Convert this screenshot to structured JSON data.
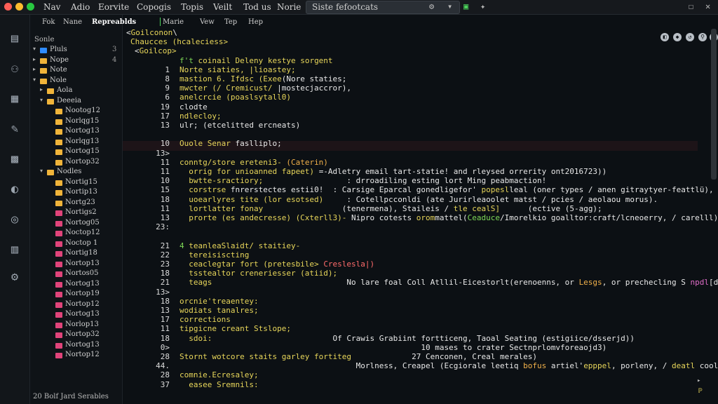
{
  "window": {
    "colors": {
      "close": "#ff5f57",
      "min": "#febc2e",
      "max": "#28c840"
    }
  },
  "menubar": {
    "items": [
      "Nav",
      "Adio",
      "Eorvite",
      "Copogis",
      "Topis",
      "Veilt",
      "Tod us",
      "Norie"
    ],
    "search_value": "Siste fefootcats"
  },
  "editor_menu": {
    "items": [
      "Fok",
      "Nane",
      "Repreablds",
      "Marie",
      "Vew",
      "Tep",
      "Hep"
    ]
  },
  "sidebar": {
    "title": "Sonle",
    "footer": "20 Bolf Jard Serables",
    "rows": [
      {
        "label": "Pluls",
        "color": "#2f8cff",
        "indent": 1,
        "chev": "▾",
        "num": "3"
      },
      {
        "label": "Nope",
        "color": "#f0b43a",
        "indent": 1,
        "chev": "▸",
        "num": "4"
      },
      {
        "label": "Note",
        "color": "#f0b43a",
        "indent": 1,
        "chev": "▸",
        "num": ""
      },
      {
        "label": "Nole",
        "color": "#f0b43a",
        "indent": 1,
        "chev": "▾",
        "num": ""
      },
      {
        "label": "Aola",
        "color": "#f0b43a",
        "indent": 2,
        "chev": "▸",
        "num": ""
      },
      {
        "label": "Deeeia",
        "color": "#f0b43a",
        "indent": 2,
        "chev": "▾",
        "num": ""
      },
      {
        "label": "Nootog12",
        "color": "#f0b43a",
        "indent": 3,
        "chev": "",
        "num": ""
      },
      {
        "label": "Norlqg15",
        "color": "#f0b43a",
        "indent": 3,
        "chev": "",
        "num": ""
      },
      {
        "label": "Nortog13",
        "color": "#f0b43a",
        "indent": 3,
        "chev": "",
        "num": ""
      },
      {
        "label": "Norlqg13",
        "color": "#f0b43a",
        "indent": 3,
        "chev": "",
        "num": ""
      },
      {
        "label": "Nortog15",
        "color": "#f0b43a",
        "indent": 3,
        "chev": "",
        "num": ""
      },
      {
        "label": "Nortop32",
        "color": "#f0b43a",
        "indent": 3,
        "chev": "",
        "num": ""
      },
      {
        "label": "Nodles",
        "color": "#f0b43a",
        "indent": 2,
        "chev": "▾",
        "num": ""
      },
      {
        "label": "Nortig15",
        "color": "#f0b43a",
        "indent": 3,
        "chev": "",
        "num": ""
      },
      {
        "label": "Nortip13",
        "color": "#f0b43a",
        "indent": 3,
        "chev": "",
        "num": ""
      },
      {
        "label": "Nortg23",
        "color": "#f0b43a",
        "indent": 3,
        "chev": "",
        "num": ""
      },
      {
        "label": "Nortigs2",
        "color": "#e0447a",
        "indent": 3,
        "chev": "",
        "num": ""
      },
      {
        "label": "Nortog05",
        "color": "#e0447a",
        "indent": 3,
        "chev": "",
        "num": ""
      },
      {
        "label": "Noctop12",
        "color": "#e0447a",
        "indent": 3,
        "chev": "",
        "num": ""
      },
      {
        "label": "Noctop 1",
        "color": "#e0447a",
        "indent": 3,
        "chev": "",
        "num": ""
      },
      {
        "label": "Nortig18",
        "color": "#e0447a",
        "indent": 3,
        "chev": "",
        "num": ""
      },
      {
        "label": "Nortop13",
        "color": "#e0447a",
        "indent": 3,
        "chev": "",
        "num": ""
      },
      {
        "label": "Nortos05",
        "color": "#e0447a",
        "indent": 3,
        "chev": "",
        "num": ""
      },
      {
        "label": "Nortog13",
        "color": "#e0447a",
        "indent": 3,
        "chev": "",
        "num": ""
      },
      {
        "label": "Nortop19",
        "color": "#e0447a",
        "indent": 3,
        "chev": "",
        "num": ""
      },
      {
        "label": "Nortop12",
        "color": "#e0447a",
        "indent": 3,
        "chev": "",
        "num": ""
      },
      {
        "label": "Nortog13",
        "color": "#e0447a",
        "indent": 3,
        "chev": "",
        "num": ""
      },
      {
        "label": "Norlop13",
        "color": "#e0447a",
        "indent": 3,
        "chev": "",
        "num": ""
      },
      {
        "label": "Nortop32",
        "color": "#e0447a",
        "indent": 3,
        "chev": "",
        "num": ""
      },
      {
        "label": "Nortog13",
        "color": "#e0447a",
        "indent": 3,
        "chev": "",
        "num": ""
      },
      {
        "label": "Nortop12",
        "color": "#e0447a",
        "indent": 3,
        "chev": "",
        "num": ""
      }
    ]
  },
  "code_lines": [
    {
      "num": "",
      "parts": [
        [
          "w",
          "<"
        ],
        [
          "y",
          "Goilconon"
        ],
        [
          "w",
          "\\"
        ]
      ]
    },
    {
      "num": "",
      "parts": [
        [
          "y",
          "Chaucces (hcaleciess>"
        ]
      ]
    },
    {
      "num": "",
      "parts": [
        [
          "w",
          "<"
        ],
        [
          "y",
          "Goilcop>"
        ]
      ]
    },
    {
      "num": "",
      "parts": [
        [
          "g",
          "f't "
        ],
        [
          "y",
          "coinail Deleny kestye sorgent"
        ]
      ]
    },
    {
      "num": "1",
      "parts": [
        [
          "y",
          "Norte siaties, |lioastey;"
        ]
      ]
    },
    {
      "num": "8",
      "parts": [
        [
          "y",
          "mastion 6. Ifdsc (Exee"
        ],
        [
          "w",
          "(Nore staties;"
        ]
      ]
    },
    {
      "num": "9",
      "parts": [
        [
          "y",
          "mwcter (/ Cremicust/ "
        ],
        [
          "w",
          "|mostecjaccror),"
        ]
      ]
    },
    {
      "num": "6",
      "parts": [
        [
          "y",
          "anelcrcie (poaslsytall0)"
        ]
      ]
    },
    {
      "num": "19",
      "parts": [
        [
          "w",
          "clodte"
        ]
      ]
    },
    {
      "num": "17",
      "parts": [
        [
          "y",
          "ndlecloy;"
        ]
      ]
    },
    {
      "num": "13",
      "parts": [
        [
          "w",
          "ulr; (etcelitted ercneats)"
        ]
      ]
    },
    {
      "num": "",
      "parts": []
    },
    {
      "num": "10",
      "parts": [
        [
          "y",
          "Ouole Senar "
        ],
        [
          "w",
          "faslliplo;"
        ]
      ]
    },
    {
      "num": "13>",
      "parts": []
    },
    {
      "num": "11",
      "parts": [
        [
          "y",
          "conntg/store ereteni3- "
        ],
        [
          "o",
          "(Caterin)"
        ]
      ]
    },
    {
      "num": "11",
      "parts": [
        [
          "y",
          "  orrig for unioanned fapeet) "
        ],
        [
          "w",
          "=-Adletry email tart-statie! and rleysed orrerity ont2016723))"
        ]
      ]
    },
    {
      "num": "10",
      "parts": [
        [
          "y",
          "  bwtte-sractiory;                  "
        ],
        [
          "w",
          ": drroadiling esting lort Ming peabmaction!"
        ]
      ]
    },
    {
      "num": "15",
      "parts": [
        [
          "y",
          "  corstrse "
        ],
        [
          "w",
          "fnrerstectes estii0!  "
        ],
        [
          "w",
          ": Carsige Eparcal gonedligefor' "
        ],
        [
          "y",
          "popesl"
        ],
        [
          "w",
          "leal (oner types / anen gitraytyer-feattlü),"
        ]
      ]
    },
    {
      "num": "18",
      "parts": [
        [
          "y",
          "  uoearlyres tite (lor esotsed)     "
        ],
        [
          "w",
          ": Cotellpcconldi (ate Jurirleaoolet matst / pcies / aeolaou morus)."
        ]
      ]
    },
    {
      "num": "11",
      "parts": [
        [
          "y",
          "  lortlatter fonay"
        ],
        [
          "w",
          "                 (tenermena), Staileis / "
        ],
        [
          "y",
          "tle cealS]"
        ],
        [
          "w",
          "      (ective (5-agg);"
        ]
      ]
    },
    {
      "num": "13",
      "parts": [
        [
          "y",
          "  prorte (es andecresse) (Cxterll3)- "
        ],
        [
          "w",
          "Nipro cotests "
        ],
        [
          "y",
          "orom"
        ],
        [
          "w",
          "mattel("
        ],
        [
          "g",
          "Ceaduce"
        ],
        [
          "w",
          "/Imorelkio goalltor:craft/lcneoerry, / carelll)"
        ]
      ]
    },
    {
      "num": "23:",
      "parts": []
    },
    {
      "num": "",
      "parts": []
    },
    {
      "num": "21",
      "parts": [
        [
          "g",
          "4 "
        ],
        [
          "y",
          "teanleaSlaidt/ staitiey-"
        ]
      ]
    },
    {
      "num": "22",
      "parts": [
        [
          "y",
          "  tereisiscting"
        ]
      ]
    },
    {
      "num": "23",
      "parts": [
        [
          "y",
          "  ceaclegtar fort (pretesbile> "
        ],
        [
          "r",
          "Creslesla|)"
        ]
      ]
    },
    {
      "num": "18",
      "parts": [
        [
          "y",
          "  tsstealtor creneriesser (atiid);"
        ]
      ]
    },
    {
      "num": "21",
      "parts": [
        [
          "y",
          "  teags                             "
        ],
        [
          "w",
          "No lare foal Coll Atllil-Eicestorlt(erenoenns, or "
        ],
        [
          "o",
          "Lesgs"
        ],
        [
          "w",
          ", or prechecling S "
        ],
        [
          "m",
          "npdl"
        ],
        [
          "w",
          "[dnd)"
        ]
      ]
    },
    {
      "num": "13>",
      "parts": []
    },
    {
      "num": "18",
      "parts": [
        [
          "y",
          "orcnie'treaentey:"
        ]
      ]
    },
    {
      "num": "13",
      "parts": [
        [
          "y",
          "wodiats tanalres;"
        ]
      ]
    },
    {
      "num": "17",
      "parts": [
        [
          "y",
          "corrections"
        ]
      ]
    },
    {
      "num": "11",
      "parts": [
        [
          "y",
          "tipgicne creant Stslope;"
        ]
      ]
    },
    {
      "num": "18",
      "parts": [
        [
          "y",
          "  sdoi:                          "
        ],
        [
          "w",
          "Of Crawis Grabiint fortticeng, Taoal Seating (estigiice/dsserjd))"
        ]
      ]
    },
    {
      "num": "0>",
      "parts": [
        [
          "w",
          "                                                    10 mases to crater Sectnprlomvforeaojd3)"
        ]
      ]
    },
    {
      "num": "28",
      "parts": [
        [
          "y",
          "Stornt wotcore staits garley fortiteg   "
        ],
        [
          "w",
          "          27 Cenconen, Creal merales)"
        ]
      ]
    },
    {
      "num": "44.",
      "parts": [
        [
          "w",
          "                                      Morlness, Creapel (Ecgiorale leetiq "
        ],
        [
          "o",
          "bofus"
        ],
        [
          "w",
          " artiel'"
        ],
        [
          "y",
          "epppel"
        ],
        [
          "w",
          ", porleny, / "
        ],
        [
          "y",
          "deatl"
        ],
        [
          "w",
          " coola)"
        ]
      ]
    },
    {
      "num": "28",
      "parts": [
        [
          "y",
          "comnie.Ecresaley;"
        ]
      ]
    },
    {
      "num": "37",
      "parts": [
        [
          "y",
          "  easee Sremnils:"
        ]
      ]
    },
    {
      "num": "",
      "parts": []
    }
  ]
}
